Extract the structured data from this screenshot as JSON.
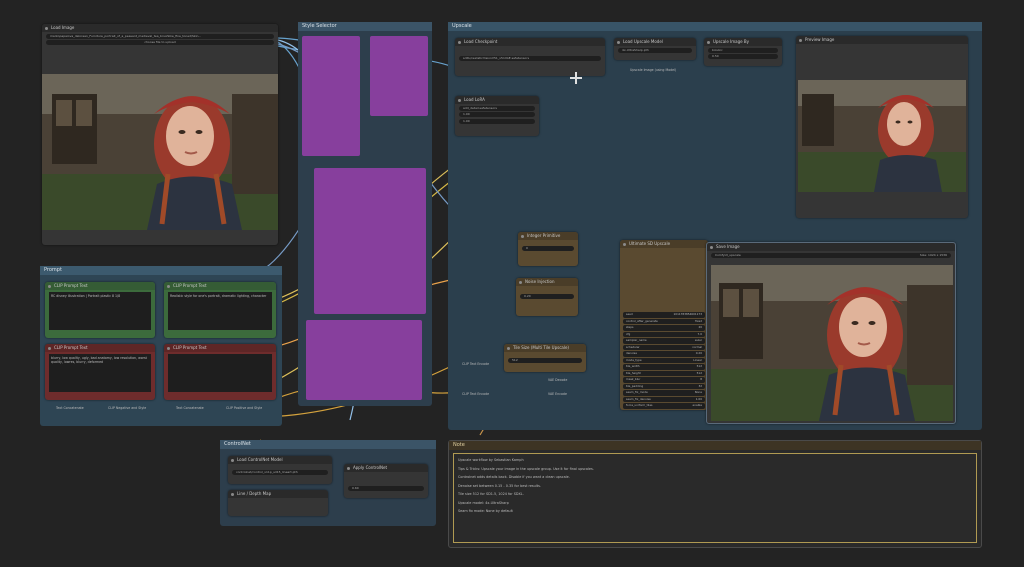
{
  "groups": {
    "style": "Style Selector",
    "prompt": "Prompt",
    "upscale": "Upscale",
    "controlnet": "ControlNet",
    "notes": "Note"
  },
  "load_image": {
    "title": "Load Image",
    "filename": "markopapaiova_delorean_Furniture_portrait_of_a_peasant_medieval_tea_brushlike_fine_toned/Skin...",
    "upload_label": "choose file to upload"
  },
  "prompt_nodes": {
    "pos1_title": "CLIP Prompt Text",
    "pos1_text": "RC disney illustration | Portrait plastic 8 1/8",
    "pos2_title": "CLIP Prompt Text",
    "pos2_text": "Realistic style for one's portrait, dramatic lighting, character",
    "neg1_title": "CLIP Prompt Text",
    "neg1_text": "blurry, low quality, ugly, bad anatomy, low resolution, worst quality, lowres, blurry, deformed",
    "neg2_title": "CLIP Prompt Text",
    "neg2_text": "",
    "footer": [
      "Text Concatenate",
      "CLIP Negative and Style",
      "Text Concatenate",
      "CLIP Positive and Style"
    ]
  },
  "upscale_nodes": {
    "checkpoint_title": "Load Checkpoint",
    "checkpoint_value": "sdXL/realisticVisionV51_v51VAE.safetensors",
    "lora_title": "Load LoRA",
    "lora_name": "add_detail.safetensors",
    "lora_strength_model": "1.00",
    "lora_strength_clip": "1.00",
    "upscale_model_title": "Load Upscale Model",
    "upscale_model_value": "4x-UltraSharp.pth",
    "upscale_with_model": "Upscale Image (using Model)",
    "upscale_by_title": "Upscale Image By",
    "upscale_method": "bicubic",
    "scale_by": "0.50",
    "preview_title": "Preview Image",
    "integer_title": "Integer Primitive",
    "integer_value": "0",
    "noise_title": "Noise Injection",
    "noise_value": "0.20",
    "tile_title": "Tile Size (Multi Tile Upscale)",
    "tile_value": "512",
    "clip_labels": [
      "CLIP Text Encode",
      "CLIP Text Encode"
    ],
    "vae_labels": [
      "VAE Decode",
      "VAE Encode"
    ],
    "sampler_title": "Ultimate SD Upscale",
    "sampler_rows": [
      [
        "seed",
        "1011783854601173"
      ],
      [
        "control_after_generate",
        "fixed"
      ],
      [
        "steps",
        "20"
      ],
      [
        "cfg",
        "7.0"
      ],
      [
        "sampler_name",
        "euler"
      ],
      [
        "scheduler",
        "normal"
      ],
      [
        "denoise",
        "0.20"
      ],
      [
        "mode_type",
        "Linear"
      ],
      [
        "tile_width",
        "512"
      ],
      [
        "tile_height",
        "512"
      ],
      [
        "mask_blur",
        "8"
      ],
      [
        "tile_padding",
        "32"
      ],
      [
        "seam_fix_mode",
        "None"
      ],
      [
        "seam_fix_denoise",
        "1.00"
      ],
      [
        "force_uniform_tiles",
        "enable"
      ]
    ],
    "save_title": "Save Image",
    "save_prefix": "ComfyUI_upscale",
    "save_size": "Size: 1024 x 1536"
  },
  "controlnet_nodes": {
    "loader_title": "Load ControlNet Model",
    "loader_value": "controlnet/control_v11p_sd15_lineart.pth",
    "apply_title": "Apply ControlNet",
    "strength": "0.60",
    "preprocessor_title": "Line / Depth Map"
  },
  "notes": {
    "title": "Note",
    "lines": [
      "Upscale workflow by Sebastian Kamph",
      "",
      "Tips & Tricks: Upscale your image in the upscale group. Use it for final upscales.",
      "",
      "Controlnet adds details back. Disable if you want a clean upscale.",
      "",
      "Denoise set between 0.15 - 0.35 for best results.",
      "",
      "Tile size 512 for SD1.5, 1024 for SDXL.",
      "",
      "Upscale model: 4x-UltraSharp",
      "",
      "Seam fix mode: None by default"
    ]
  },
  "colors": {
    "upscale_group": "#2b3f4d",
    "prompt_group": "#2e4554",
    "style_group": "#2d3e4c",
    "notes_border": "#b09a52",
    "purple": "#9b3fb0",
    "node_green": "#3c6b3c",
    "node_red": "#6e2c2c"
  }
}
